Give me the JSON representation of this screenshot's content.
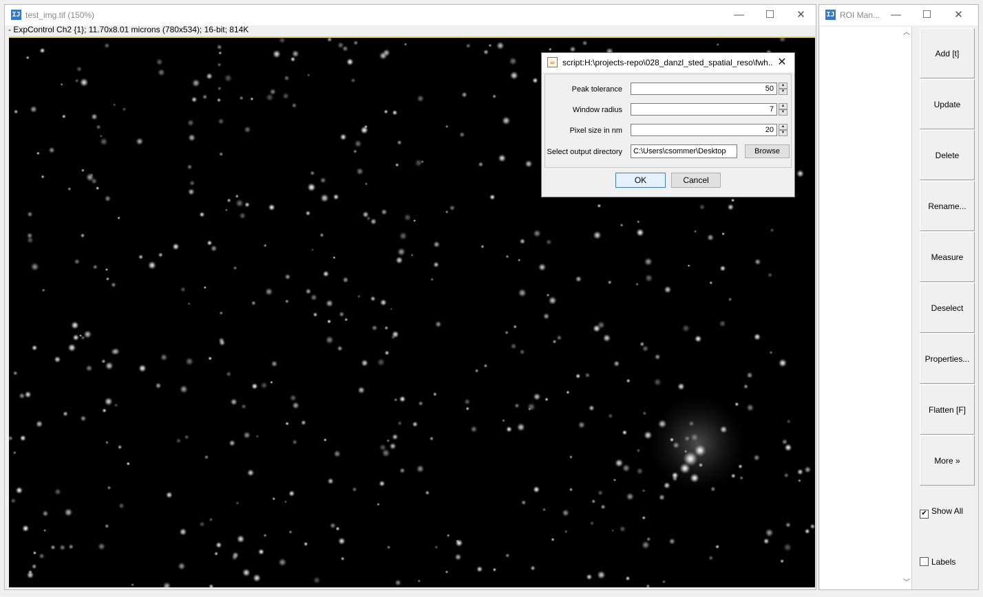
{
  "image_window": {
    "title": "test_img.tif (150%)",
    "info": "- ExpControl Ch2 {1}; 11.70x8.01 microns (780x534); 16-bit; 814K",
    "controls": {
      "minimize": "—",
      "maximize": "☐",
      "close": "✕"
    }
  },
  "dialog": {
    "title": "script:H:\\projects-repo\\028_danzl_sted_spatial_reso\\fwh...",
    "close": "✕",
    "fields": [
      {
        "label": "Peak tolerance",
        "value": "50"
      },
      {
        "label": "Window radius",
        "value": "7"
      },
      {
        "label": "Pixel size in nm",
        "value": "20"
      }
    ],
    "output_dir": {
      "label": "Select output directory",
      "value": "C:\\Users\\csommer\\Desktop",
      "browse": "Browse"
    },
    "ok": "OK",
    "cancel": "Cancel"
  },
  "roi_manager": {
    "title": "ROI Man...",
    "controls": {
      "minimize": "—",
      "maximize": "☐",
      "close": "✕"
    },
    "buttons": [
      "Add [t]",
      "Update",
      "Delete",
      "Rename...",
      "Measure",
      "Deselect",
      "Properties...",
      "Flatten [F]",
      "More »"
    ],
    "show_all": {
      "label": "Show All",
      "checked": true
    },
    "labels": {
      "label": "Labels",
      "checked": false
    }
  },
  "icons": {
    "app": "imagej-icon",
    "dialog": "java-icon"
  }
}
